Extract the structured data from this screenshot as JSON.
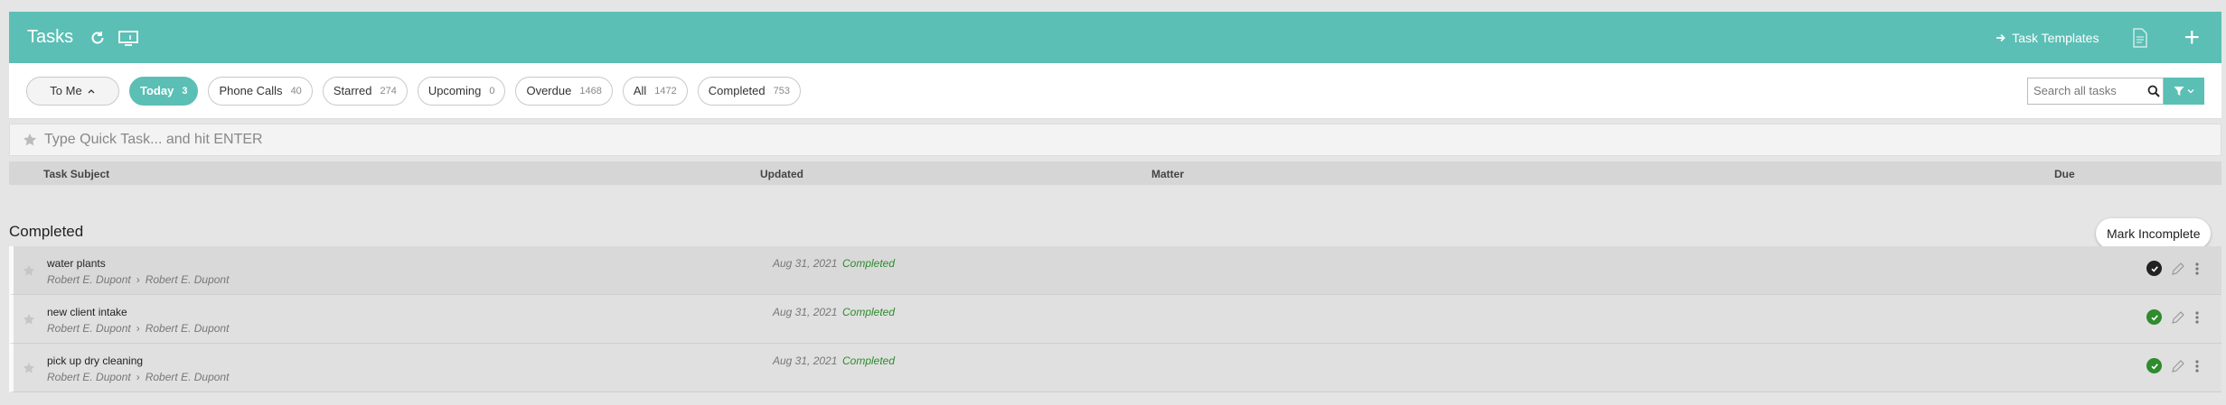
{
  "header": {
    "title": "Tasks",
    "task_templates_label": "Task Templates",
    "icons": [
      "refresh-icon",
      "screen-icon",
      "template-arrow-icon",
      "document-icon",
      "plus-icon"
    ]
  },
  "filters": {
    "to_me_label": "To Me",
    "pills": [
      {
        "label": "Today",
        "count": "3",
        "active": true
      },
      {
        "label": "Phone Calls",
        "count": "40"
      },
      {
        "label": "Starred",
        "count": "274"
      },
      {
        "label": "Upcoming",
        "count": "0"
      },
      {
        "label": "Overdue",
        "count": "1468"
      },
      {
        "label": "All",
        "count": "1472"
      },
      {
        "label": "Completed",
        "count": "753"
      }
    ],
    "search_placeholder": "Search all tasks"
  },
  "quick_task": {
    "placeholder": "Type Quick Task... and hit ENTER"
  },
  "table": {
    "columns": {
      "subject": "Task Subject",
      "updated": "Updated",
      "matter": "Matter",
      "due": "Due"
    }
  },
  "completed": {
    "title": "Completed",
    "tooltip": "Mark Incomplete",
    "rows": [
      {
        "subject": "water plants",
        "from": "Robert E. Dupont",
        "to": "Robert E. Dupont",
        "updated": "Aug 31, 2021",
        "status": "Completed"
      },
      {
        "subject": "new client intake",
        "from": "Robert E. Dupont",
        "to": "Robert E. Dupont",
        "updated": "Aug 31, 2021",
        "status": "Completed"
      },
      {
        "subject": "pick up dry cleaning",
        "from": "Robert E. Dupont",
        "to": "Robert E. Dupont",
        "updated": "Aug 31, 2021",
        "status": "Completed"
      }
    ]
  },
  "colors": {
    "accent": "#5bbfb5",
    "completed": "#2e8b2e"
  }
}
